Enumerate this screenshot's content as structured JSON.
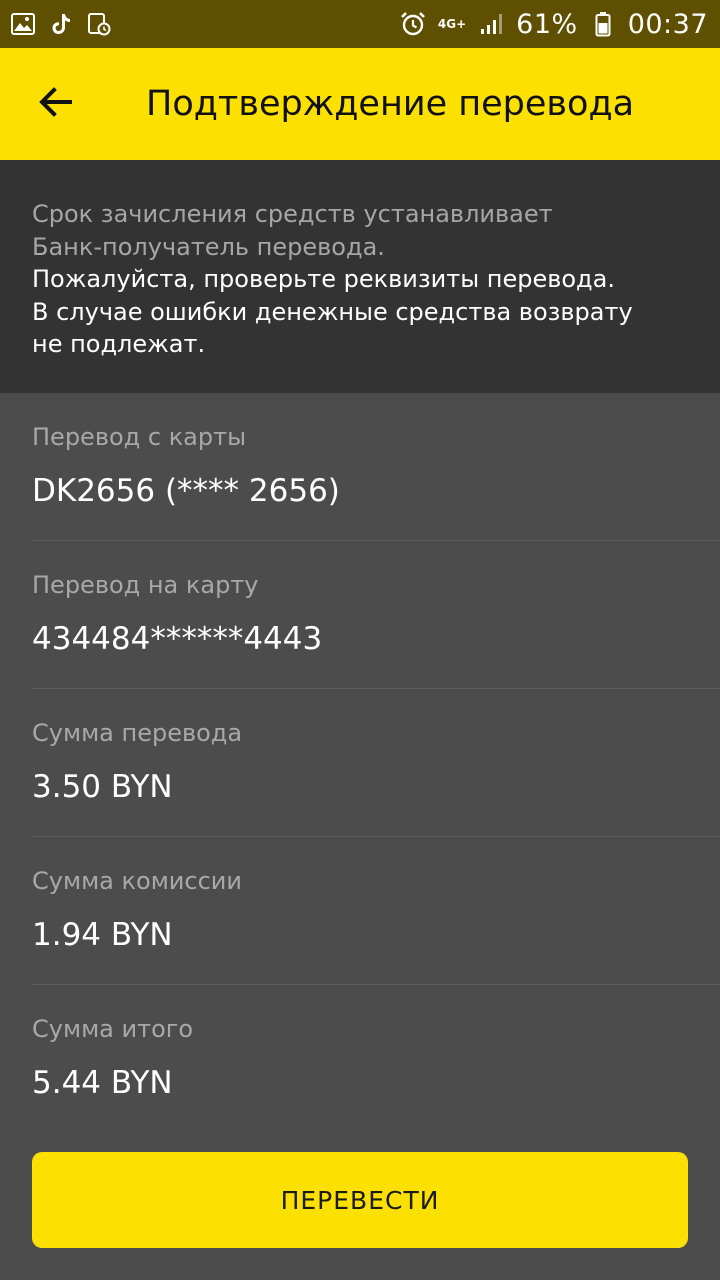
{
  "status_bar": {
    "left_icons": [
      "gallery-icon",
      "tiktok-icon",
      "media-timer-icon"
    ],
    "right_icons": [
      "alarm-icon",
      "signal-icon",
      "battery-icon"
    ],
    "network": "4G+",
    "battery_percent": "61%",
    "time": "00:37",
    "background": "#5f4f00"
  },
  "app_bar": {
    "back_icon": "arrow-left-icon",
    "title": "Подтверждение перевода",
    "background": "#fbe000"
  },
  "notice": {
    "muted_lines": [
      "Срок зачисления средств устанавливает",
      "Банк-получатель перевода."
    ],
    "bright_lines": [
      "Пожалуйста, проверьте реквизиты перевода.",
      "В случае ошибки денежные средства возврату",
      "не подлежат."
    ]
  },
  "details": [
    {
      "label": "Перевод с карты",
      "value": "DK2656 (**** 2656)"
    },
    {
      "label": "Перевод на карту",
      "value": "434484******4443"
    },
    {
      "label": "Сумма перевода",
      "value": "3.50 BYN"
    },
    {
      "label": "Сумма комиссии",
      "value": "1.94 BYN"
    },
    {
      "label": "Сумма итого",
      "value": "5.44 BYN"
    }
  ],
  "actions": {
    "confirm_label": "ПЕРЕВЕСТИ",
    "accent": "#fbe000"
  }
}
